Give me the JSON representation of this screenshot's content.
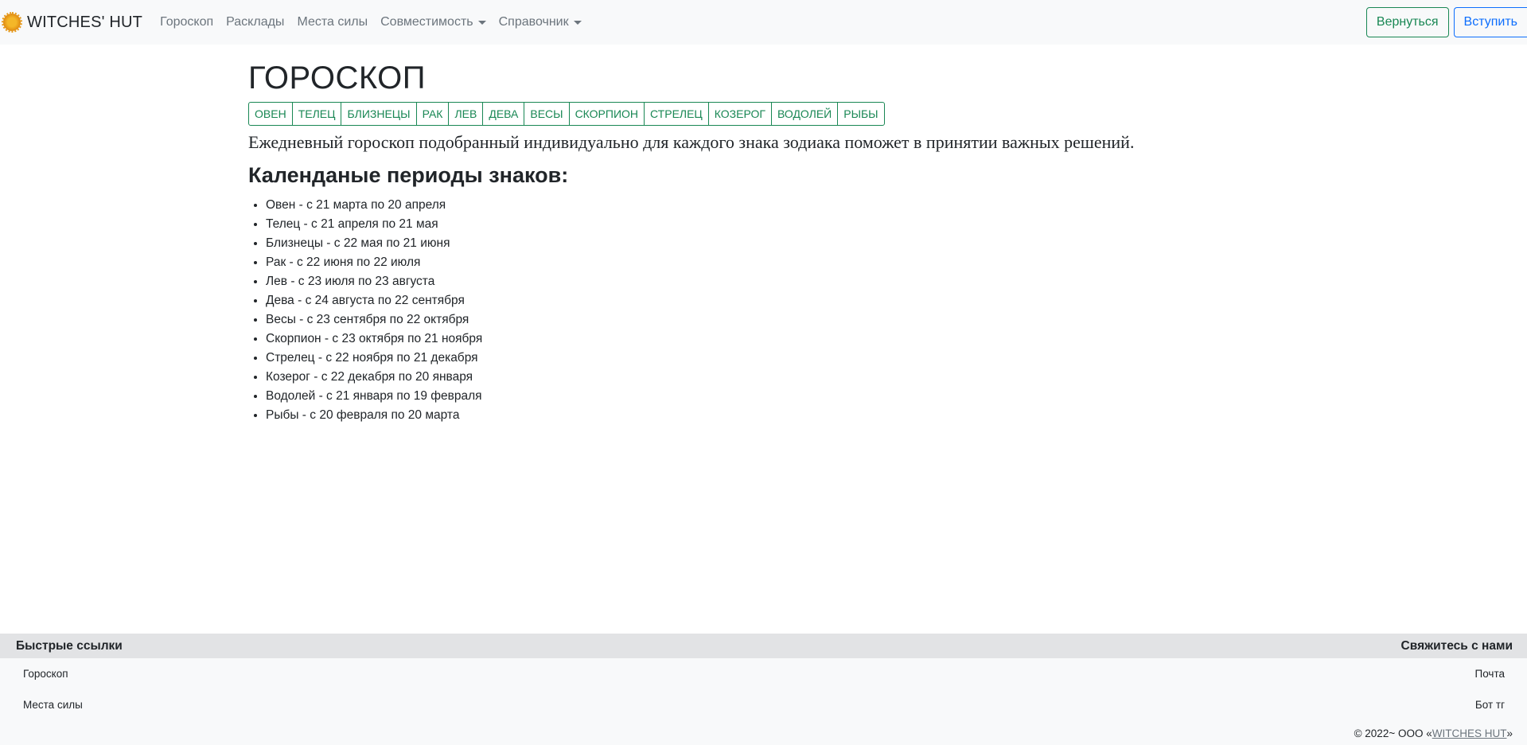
{
  "navbar": {
    "brand": "WITCHES' HUT",
    "links": [
      "Гороскоп",
      "Расклады",
      "Места силы"
    ],
    "dropdowns": [
      "Совместимость",
      "Справочник"
    ],
    "back_button": "Вернуться",
    "join_button": "Вступить"
  },
  "main": {
    "title": "ГОРОСКОП",
    "signs": [
      "ОВЕН",
      "ТЕЛЕЦ",
      "БЛИЗНЕЦЫ",
      "РАК",
      "ЛЕВ",
      "ДЕВА",
      "ВЕСЫ",
      "СКОРПИОН",
      "СТРЕЛЕЦ",
      "КОЗЕРОГ",
      "ВОДОЛЕЙ",
      "РЫБЫ"
    ],
    "intro": "Ежедневный гороскоп подобранный индивидуально для каждого знака зодиака поможет в принятии важных решений.",
    "periods_title": "Календаные периоды знаков:",
    "periods": [
      "Овен - с 21 марта по 20 апреля",
      "Телец - с 21 апреля по 21 мая",
      "Близнецы - с 22 мая по 21 июня",
      "Рак - с 22 июня по 22 июля",
      "Лев - с 23 июля по 23 августа",
      "Дева - с 24 августа по 22 сентября",
      "Весы - с 23 сентября по 22 октября",
      "Скорпион - с 23 октября по 21 ноября",
      "Стрелец - с 22 ноября по 21 декабря",
      "Козерог - с 22 декабря по 20 января",
      "Водолей - с 21 января по 19 февраля",
      "Рыбы - с 20 февраля по 20 марта"
    ]
  },
  "footer": {
    "quick_links_title": "Быстрые ссылки",
    "contact_title": "Свяжитесь с нами",
    "quick_links": [
      "Гороскоп",
      "Места силы"
    ],
    "contacts": [
      "Почта",
      "Бот тг"
    ],
    "copyright_prefix": "© 2022~ ООО «",
    "copyright_link": "WITCHES HUT",
    "copyright_suffix": "»"
  },
  "colors": {
    "accent_green": "#198754",
    "accent_blue": "#0d6efd",
    "navbar_bg": "#f8f9fa",
    "footer_head_bg": "#e2e3e5"
  }
}
